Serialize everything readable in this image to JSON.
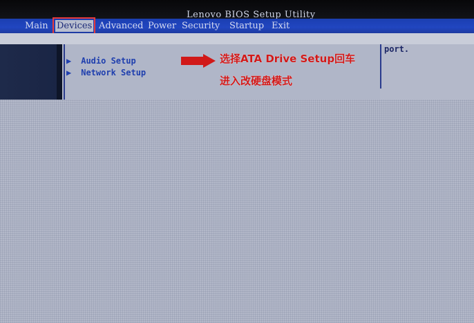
{
  "window": {
    "title": "Lenovo BIOS Setup Utility"
  },
  "menu": {
    "items": [
      {
        "label": "Main",
        "active": false
      },
      {
        "label": "Devices",
        "active": true
      },
      {
        "label": "Advanced",
        "active": false
      },
      {
        "label": "Power",
        "active": false
      },
      {
        "label": "Security",
        "active": false
      },
      {
        "label": "Startup",
        "active": false
      },
      {
        "label": "Exit",
        "active": false
      }
    ]
  },
  "setup": {
    "items": [
      {
        "label": "Audio Setup",
        "icon": "triangle-right-icon"
      },
      {
        "label": "Network Setup",
        "icon": "triangle-right-icon"
      }
    ]
  },
  "help": {
    "text": "port."
  },
  "annotation": {
    "line1": "选择ATA Drive Setup回车",
    "line2": "进入改硬盘模式",
    "color": "#d11919"
  },
  "colors": {
    "menu_bar": "#2146c0",
    "highlight_box": "#e83a3a",
    "item_text": "#1f3fae"
  }
}
